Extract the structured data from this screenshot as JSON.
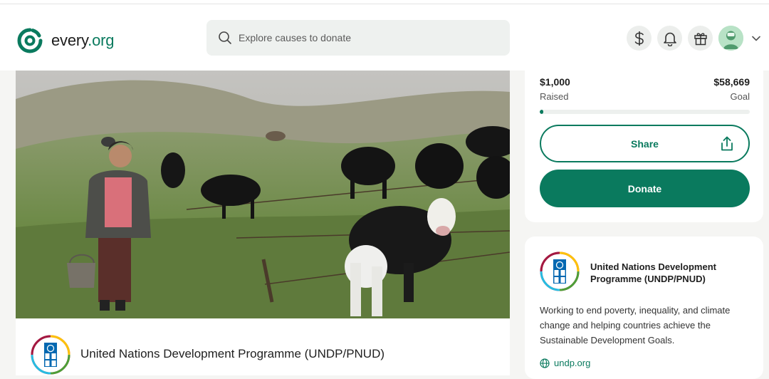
{
  "header": {
    "logo_text_main": "every",
    "logo_text_org": ".org",
    "search_placeholder": "Explore causes to donate",
    "icons": [
      "dollar-icon",
      "bell-icon",
      "gift-icon",
      "avatar",
      "chevron-down-icon"
    ]
  },
  "hero": {
    "alt": "Woman standing with a bucket among grazing yaks on a misty green hillside"
  },
  "main": {
    "org_name": "United Nations Development Programme (UNDP/PNUD)"
  },
  "fundraiser": {
    "raised_amount": "$1,000",
    "raised_label": "Raised",
    "goal_amount": "$58,669",
    "goal_label": "Goal",
    "progress_fraction": 0.017,
    "share_label": "Share",
    "donate_label": "Donate"
  },
  "org_card": {
    "name": "United Nations Development Programme (UNDP/PNUD)",
    "description": "Working to end poverty, inequality, and climate change and helping countries achieve the Sustainable Development Goals.",
    "website": "undp.org"
  },
  "colors": {
    "brand_green": "#0a7a5e",
    "page_bg": "#f5f5f3"
  }
}
